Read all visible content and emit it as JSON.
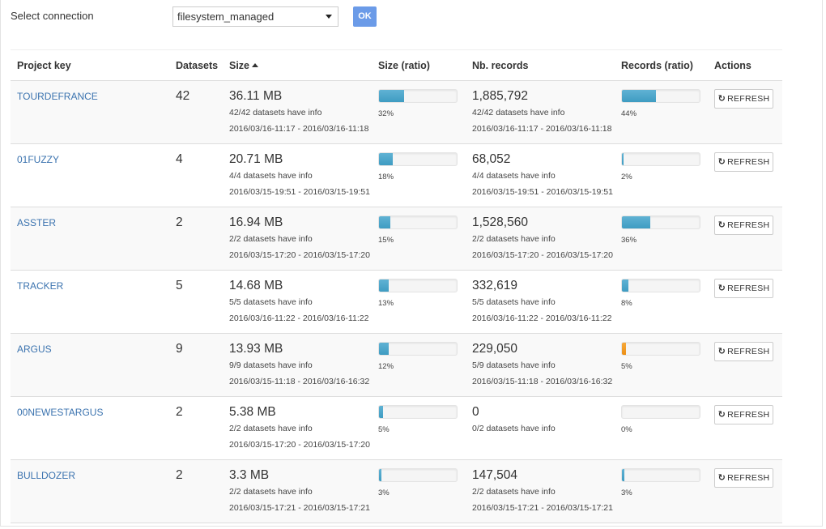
{
  "connection": {
    "label": "Select connection",
    "selected": "filesystem_managed",
    "ok_label": "OK"
  },
  "table": {
    "headers": {
      "project_key": "Project key",
      "datasets": "Datasets",
      "size": "Size",
      "size_ratio": "Size (ratio)",
      "nb_records": "Nb. records",
      "records_ratio": "Records (ratio)",
      "actions": "Actions"
    },
    "sorted_column": "size",
    "sort_direction": "ascending-icon",
    "refresh_label": "REFRESH",
    "refresh_icon": "refresh-icon",
    "colors": {
      "link": "#3b73af",
      "bar": "#4aa3c9",
      "bar_low": "#f0961d"
    },
    "rows": [
      {
        "key": "TOURDEFRANCE",
        "datasets": "42",
        "size": "36.11 MB",
        "size_info": "42/42 datasets have info",
        "size_dates": "2016/03/16-11:17 - 2016/03/16-11:18",
        "size_ratio": 32,
        "size_ratio_label": "32%",
        "records": "1,885,792",
        "records_info": "42/42 datasets have info",
        "records_dates": "2016/03/16-11:17 - 2016/03/16-11:18",
        "records_ratio": 44,
        "records_ratio_label": "44%",
        "records_bar_color": "blue"
      },
      {
        "key": "01FUZZY",
        "datasets": "4",
        "size": "20.71 MB",
        "size_info": "4/4 datasets have info",
        "size_dates": "2016/03/15-19:51 - 2016/03/15-19:51",
        "size_ratio": 18,
        "size_ratio_label": "18%",
        "records": "68,052",
        "records_info": "4/4 datasets have info",
        "records_dates": "2016/03/15-19:51 - 2016/03/15-19:51",
        "records_ratio": 2,
        "records_ratio_label": "2%",
        "records_bar_color": "blue"
      },
      {
        "key": "ASSTER",
        "datasets": "2",
        "size": "16.94 MB",
        "size_info": "2/2 datasets have info",
        "size_dates": "2016/03/15-17:20 - 2016/03/15-17:20",
        "size_ratio": 15,
        "size_ratio_label": "15%",
        "records": "1,528,560",
        "records_info": "2/2 datasets have info",
        "records_dates": "2016/03/15-17:20 - 2016/03/15-17:20",
        "records_ratio": 36,
        "records_ratio_label": "36%",
        "records_bar_color": "blue"
      },
      {
        "key": "TRACKER",
        "datasets": "5",
        "size": "14.68 MB",
        "size_info": "5/5 datasets have info",
        "size_dates": "2016/03/16-11:22 - 2016/03/16-11:22",
        "size_ratio": 13,
        "size_ratio_label": "13%",
        "records": "332,619",
        "records_info": "5/5 datasets have info",
        "records_dates": "2016/03/16-11:22 - 2016/03/16-11:22",
        "records_ratio": 8,
        "records_ratio_label": "8%",
        "records_bar_color": "blue"
      },
      {
        "key": "ARGUS",
        "datasets": "9",
        "size": "13.93 MB",
        "size_info": "9/9 datasets have info",
        "size_dates": "2016/03/15-11:18 - 2016/03/16-16:32",
        "size_ratio": 12,
        "size_ratio_label": "12%",
        "records": "229,050",
        "records_info": "5/9 datasets have info",
        "records_dates": "2016/03/15-11:18 - 2016/03/16-16:32",
        "records_ratio": 5,
        "records_ratio_label": "5%",
        "records_bar_color": "orange"
      },
      {
        "key": "00NEWESTARGUS",
        "datasets": "2",
        "size": "5.38 MB",
        "size_info": "2/2 datasets have info",
        "size_dates": "2016/03/15-17:20 - 2016/03/15-17:20",
        "size_ratio": 5,
        "size_ratio_label": "5%",
        "records": "0",
        "records_info": "0/2 datasets have info",
        "records_dates": "",
        "records_ratio": 0,
        "records_ratio_label": "0%",
        "records_bar_color": "blue"
      },
      {
        "key": "BULLDOZER",
        "datasets": "2",
        "size": "3.3 MB",
        "size_info": "2/2 datasets have info",
        "size_dates": "2016/03/15-17:21 - 2016/03/15-17:21",
        "size_ratio": 3,
        "size_ratio_label": "3%",
        "records": "147,504",
        "records_info": "2/2 datasets have info",
        "records_dates": "2016/03/15-17:21 - 2016/03/15-17:21",
        "records_ratio": 3,
        "records_ratio_label": "3%",
        "records_bar_color": "blue"
      }
    ]
  }
}
